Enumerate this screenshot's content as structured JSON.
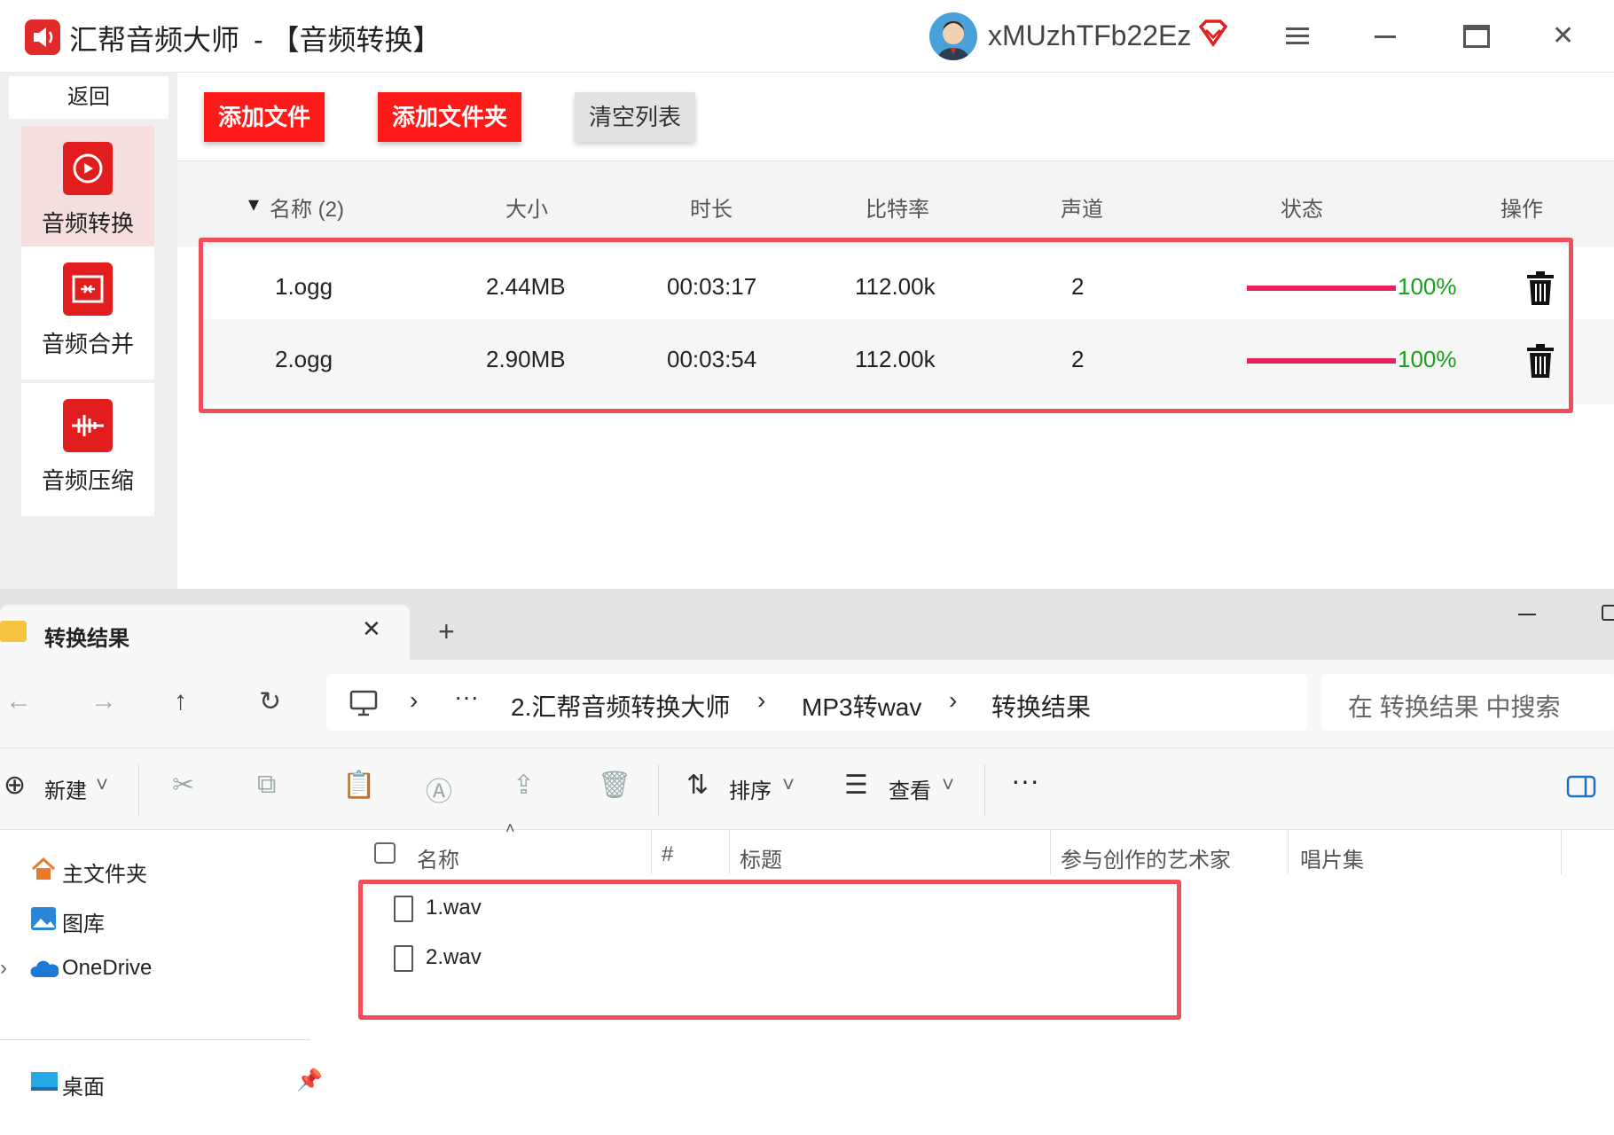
{
  "app": {
    "title": "汇帮音频大师",
    "subtitle": "-  【音频转换】",
    "username": "xMUzhTFb22Ez",
    "colors": {
      "accent": "#ff1a1a",
      "progress": "#e8225e",
      "success": "#18a018",
      "highlight": "#ef4f58"
    }
  },
  "sidebar": {
    "back_label": "返回",
    "items": [
      {
        "label": "音频转换",
        "icon": "audio-convert-icon",
        "active": true
      },
      {
        "label": "音频合并",
        "icon": "audio-merge-icon",
        "active": false
      },
      {
        "label": "音频压缩",
        "icon": "audio-compress-icon",
        "active": false
      }
    ]
  },
  "toolbar": {
    "add_file": "添加文件",
    "add_folder": "添加文件夹",
    "clear_list": "清空列表"
  },
  "table": {
    "headers": {
      "name": "名称 (2)",
      "size": "大小",
      "duration": "时长",
      "bitrate": "比特率",
      "channels": "声道",
      "status": "状态",
      "action": "操作"
    },
    "rows": [
      {
        "name": "1.ogg",
        "size": "2.44MB",
        "duration": "00:03:17",
        "bitrate": "112.00k",
        "channels": "2",
        "progress_percent": 100,
        "progress_label": "100%"
      },
      {
        "name": "2.ogg",
        "size": "2.90MB",
        "duration": "00:03:54",
        "bitrate": "112.00k",
        "channels": "2",
        "progress_percent": 100,
        "progress_label": "100%"
      }
    ]
  },
  "explorer": {
    "tab_title": "转换结果",
    "breadcrumb": [
      "2.汇帮音频转换大师",
      "MP3转wav",
      "转换结果"
    ],
    "search_placeholder": "在 转换结果 中搜索",
    "commands": {
      "new": "新建",
      "sort": "排序",
      "view": "查看"
    },
    "nav_items": [
      "主文件夹",
      "图库",
      "OneDrive",
      "桌面"
    ],
    "columns": {
      "name": "名称",
      "number": "#",
      "title": "标题",
      "artist": "参与创作的艺术家",
      "album": "唱片集"
    },
    "files": [
      "1.wav",
      "2.wav"
    ]
  }
}
